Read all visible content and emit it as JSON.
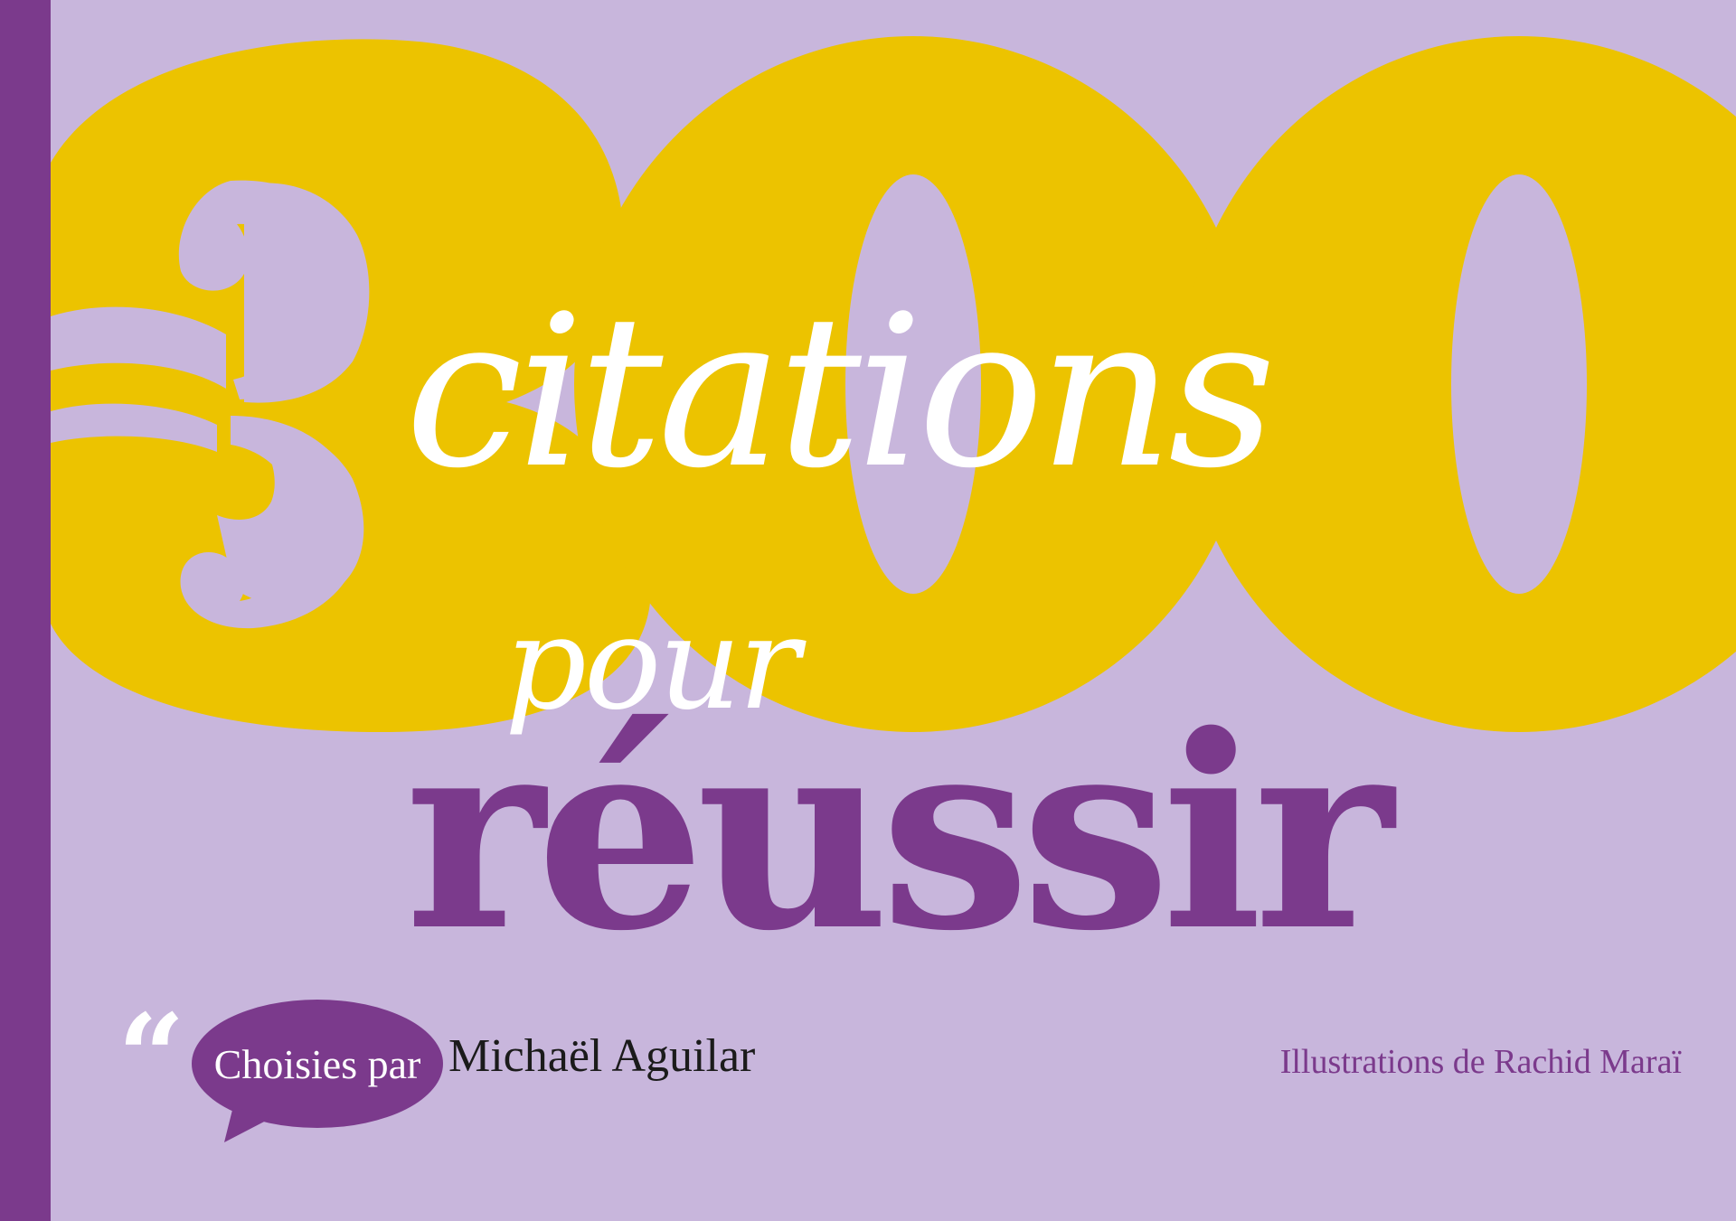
{
  "cover": {
    "number": "300",
    "title_line1": "citations",
    "title_line2": "pour",
    "title_line3": "réussir",
    "quote_glyph": "“",
    "chosen_by_label": "Choisies par",
    "author": "Michaël Aguilar",
    "illustrator_credit": "Illustrations de Rachid Maraï"
  },
  "colors": {
    "background": "#c8b6dc",
    "spine": "#7b3a8c",
    "number": "#ecc300",
    "title_white": "#ffffff",
    "title_purple": "#7b3a8c",
    "bubble": "#7b3a8c",
    "author_text": "#1b1b1b"
  }
}
